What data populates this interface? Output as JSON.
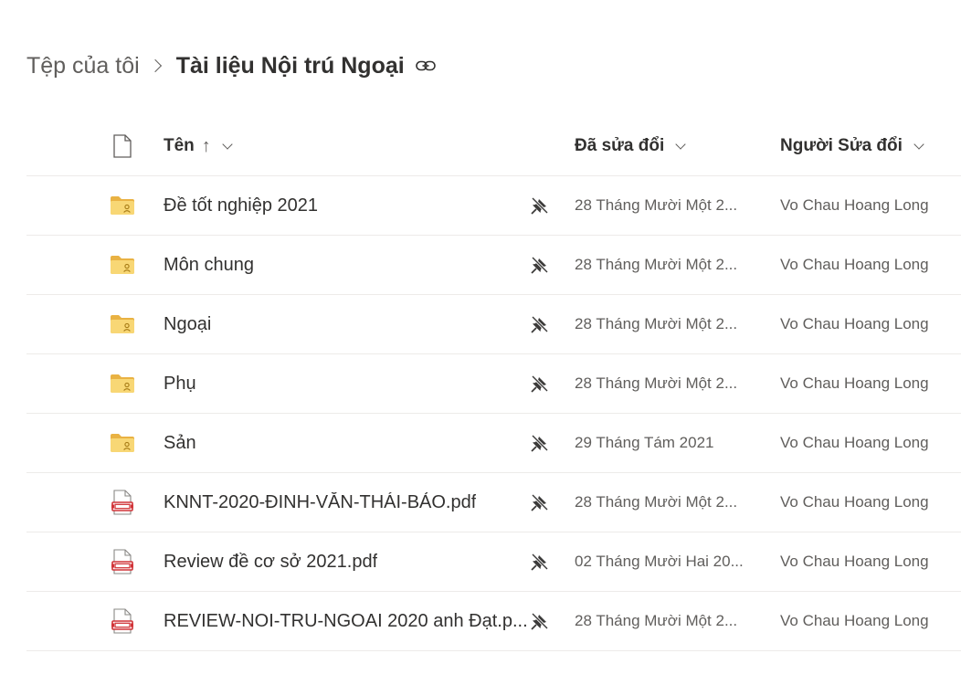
{
  "breadcrumb": {
    "root": "Tệp của tôi",
    "current": "Tài liệu Nội trú Ngoại"
  },
  "columns": {
    "name": "Tên",
    "name_sort_arrow": "↑",
    "modified": "Đã sửa đổi",
    "modified_by": "Người Sửa đổi"
  },
  "rows": [
    {
      "type": "shared-folder",
      "name": "Đề tốt nghiệp 2021",
      "modified": "28 Tháng Mười Một 2...",
      "modified_by": "Vo Chau Hoang Long"
    },
    {
      "type": "shared-folder",
      "name": "Môn chung",
      "modified": "28 Tháng Mười Một 2...",
      "modified_by": "Vo Chau Hoang Long"
    },
    {
      "type": "shared-folder",
      "name": "Ngoại",
      "modified": "28 Tháng Mười Một 2...",
      "modified_by": "Vo Chau Hoang Long"
    },
    {
      "type": "shared-folder",
      "name": "Phụ",
      "modified": "28 Tháng Mười Một 2...",
      "modified_by": "Vo Chau Hoang Long"
    },
    {
      "type": "shared-folder",
      "name": "Sản",
      "modified": "29 Tháng Tám 2021",
      "modified_by": "Vo Chau Hoang Long"
    },
    {
      "type": "pdf",
      "name": "KNNT-2020-ĐINH-VĂN-THÁI-BẢO.pdf",
      "modified": "28 Tháng Mười Một 2...",
      "modified_by": "Vo Chau Hoang Long"
    },
    {
      "type": "pdf",
      "name": "Review đề cơ sở 2021.pdf",
      "modified": "02 Tháng Mười Hai 20...",
      "modified_by": "Vo Chau Hoang Long"
    },
    {
      "type": "pdf",
      "name": "REVIEW-NOI-TRU-NGOAI 2020 anh Đạt.p...",
      "modified": "28 Tháng Mười Một 2...",
      "modified_by": "Vo Chau Hoang Long"
    }
  ],
  "icons": {
    "folder": "shared-folder-icon",
    "pdf": "pdf-file-icon",
    "action": "unpin-icon",
    "link": "link-icon",
    "header": "file-type-icon"
  },
  "colors": {
    "folder": "#f8d775",
    "folder_dark": "#e9b243",
    "pdf_red": "#d13438",
    "text": "#323130",
    "muted": "#605e5c",
    "divider": "#edebe9"
  }
}
